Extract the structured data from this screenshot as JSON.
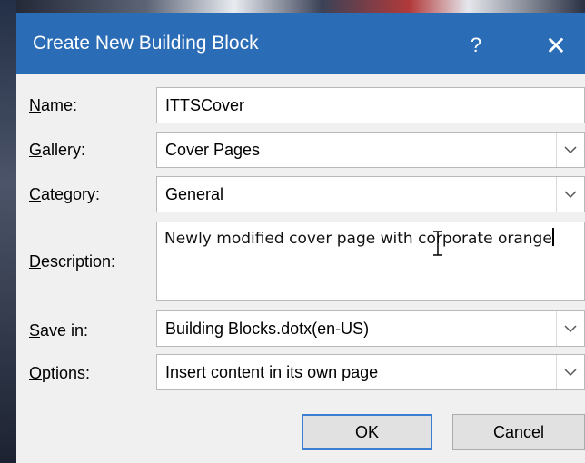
{
  "dialog": {
    "title": "Create New Building Block",
    "help_label": "?",
    "close_label": "✕"
  },
  "fields": {
    "name": {
      "label_accel": "N",
      "label_rest": "ame:",
      "value": "ITTSCover"
    },
    "gallery": {
      "label_accel": "G",
      "label_rest": "allery:",
      "value": "Cover Pages"
    },
    "category": {
      "label_accel": "C",
      "label_rest": "ategory:",
      "value": "General"
    },
    "description": {
      "label_accel": "D",
      "label_rest": "escription:",
      "value": "Newly modified cover page with corporate orange"
    },
    "save_in": {
      "label_accel": "S",
      "label_rest": "ave in:",
      "value": "Building Blocks.dotx(en-US)"
    },
    "options": {
      "label_accel": "O",
      "label_rest": "ptions:",
      "value": "Insert content in its own page"
    }
  },
  "buttons": {
    "ok": "OK",
    "cancel": "Cancel"
  },
  "icons": {
    "dropdown": "chevron-down-icon",
    "cursor": "text-cursor-icon"
  },
  "colors": {
    "titlebar": "#2b6cb6",
    "ok_border": "#3c7fd0"
  }
}
